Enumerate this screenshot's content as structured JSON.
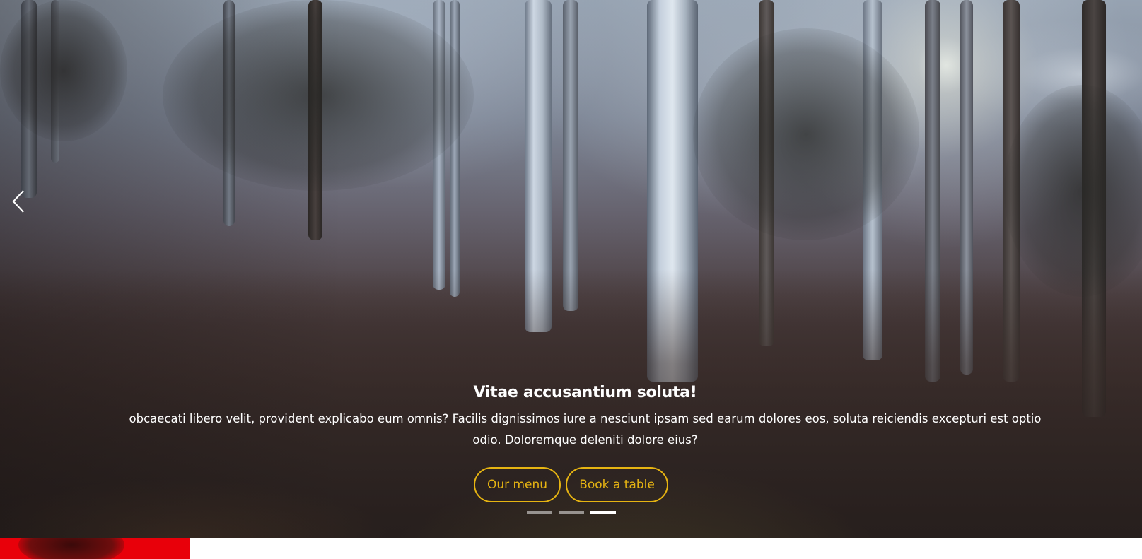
{
  "hero": {
    "title": "Vitae accusantium soluta!",
    "description": "obcaecati libero velit, provident explicabo eum omnis? Facilis dignissimos iure a nesciunt ipsam sed earum dolores eos, soluta reiciendis excepturi est optio odio. Doloremque deleniti dolore eius?",
    "buttons": {
      "menu_label": "Our menu",
      "book_label": "Book a table"
    },
    "prev_icon": "chevron-left-icon",
    "indicators": {
      "count": 3,
      "active_index": 2
    }
  },
  "colors": {
    "accent": "#e6b412",
    "caption_text": "#ffffff",
    "promo_red": "#e8000a"
  }
}
